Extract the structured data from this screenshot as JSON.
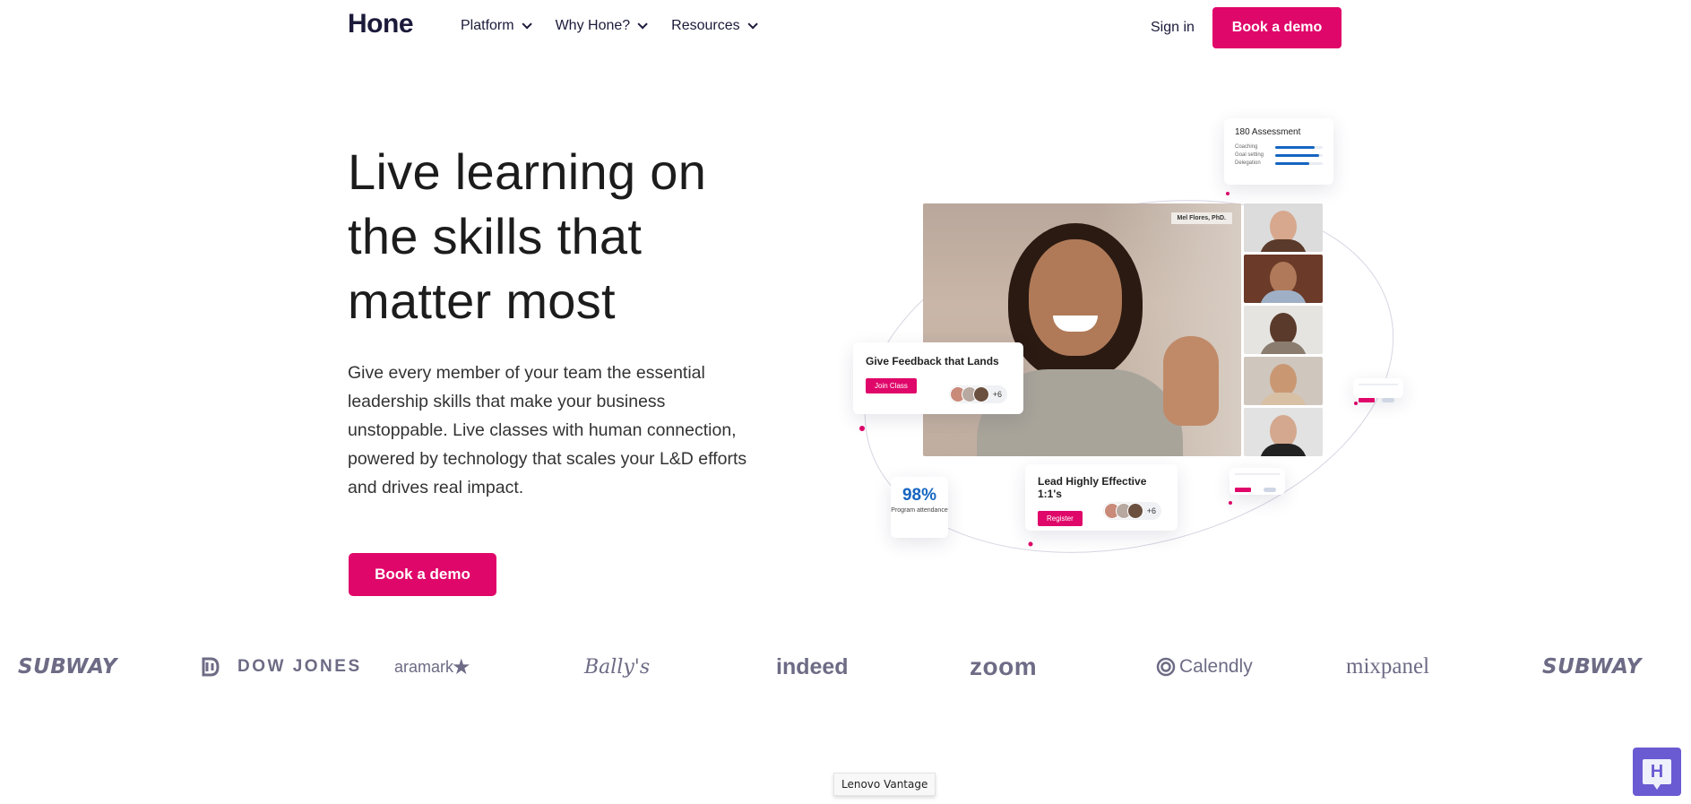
{
  "header": {
    "logo": "Hone",
    "nav": [
      {
        "label": "Platform"
      },
      {
        "label": "Why Hone?"
      },
      {
        "label": "Resources"
      }
    ],
    "sign_in": "Sign in",
    "cta": "Book a demo"
  },
  "hero": {
    "title": "Live learning on the skills that matter most",
    "description": "Give every member of your team the essential leadership skills that make your business unstoppable. Live classes with human connection, powered by technology that scales your L&D efforts and drives real impact.",
    "cta": "Book a demo"
  },
  "illustration": {
    "presenter_name": "Mel Flores, PhD.",
    "assessment": {
      "title": "180 Assessment",
      "items": [
        {
          "label": "Coaching",
          "progress": 0.82
        },
        {
          "label": "Goal setting",
          "progress": 0.92
        },
        {
          "label": "Delegation",
          "progress": 0.72
        }
      ]
    },
    "class_card_1": {
      "title": "Give Feedback that Lands",
      "button": "Join Class",
      "extra": "+6"
    },
    "class_card_2": {
      "title": "Lead Highly Effective 1:1's",
      "button": "Register",
      "extra": "+6"
    },
    "stat": {
      "value": "98%",
      "label": "Program attendance"
    },
    "colors": {
      "accent": "#e0076a",
      "blue": "#1565c0"
    }
  },
  "logos": [
    "SUBWAY",
    "DOW JONES",
    "aramark",
    "Bally's",
    "indeed",
    "zoom",
    "Calendly",
    "mixpanel",
    "SUBWAY"
  ],
  "tooltip": "Lenovo Vantage",
  "chat": {
    "icon_letter": "H"
  }
}
